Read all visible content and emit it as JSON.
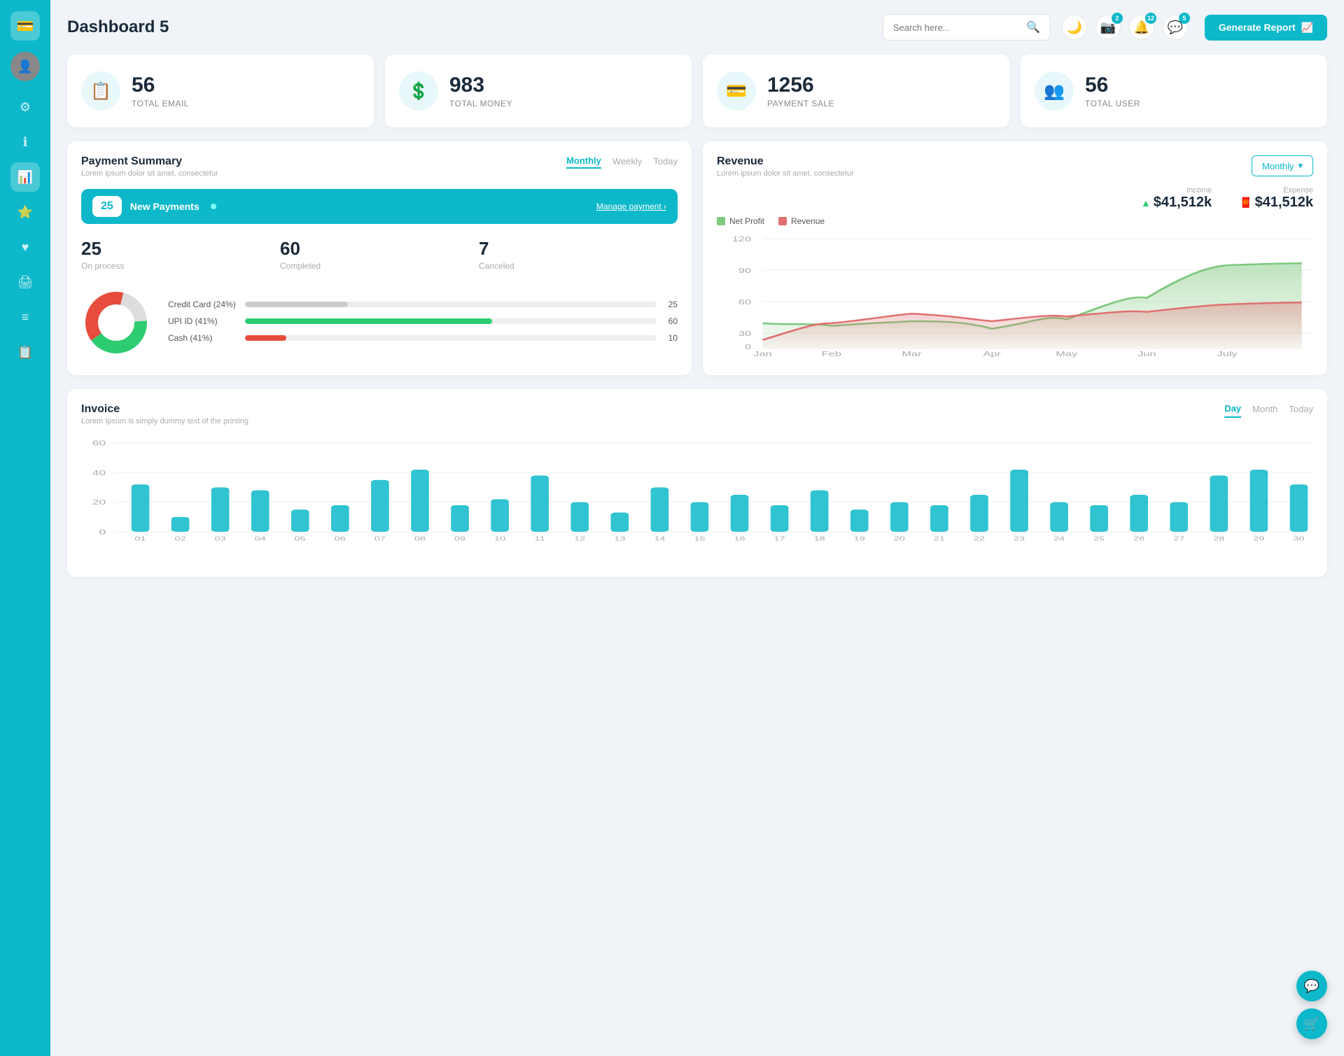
{
  "sidebar": {
    "logo_icon": "💳",
    "avatar_icon": "👤",
    "items": [
      {
        "icon": "⚙",
        "label": "settings",
        "active": false
      },
      {
        "icon": "ℹ",
        "label": "info",
        "active": false
      },
      {
        "icon": "📊",
        "label": "analytics",
        "active": true
      },
      {
        "icon": "⭐",
        "label": "favorites",
        "active": false
      },
      {
        "icon": "❤",
        "label": "likes",
        "active": false
      },
      {
        "icon": "🖨",
        "label": "print",
        "active": false
      },
      {
        "icon": "≡",
        "label": "menu",
        "active": false
      },
      {
        "icon": "📋",
        "label": "list",
        "active": false
      }
    ]
  },
  "header": {
    "title": "Dashboard 5",
    "search_placeholder": "Search here...",
    "badge_camera": "2",
    "badge_bell": "12",
    "badge_chat": "5",
    "generate_btn": "Generate Report"
  },
  "stats": [
    {
      "value": "56",
      "label": "TOTAL EMAIL",
      "icon": "📋"
    },
    {
      "value": "983",
      "label": "TOTAL MONEY",
      "icon": "$"
    },
    {
      "value": "1256",
      "label": "PAYMENT SALE",
      "icon": "💳"
    },
    {
      "value": "56",
      "label": "TOTAL USER",
      "icon": "👥"
    }
  ],
  "payment_summary": {
    "title": "Payment Summary",
    "subtitle": "Lorem ipsum dolor sit amet, consectetur",
    "tabs": [
      "Monthly",
      "Weekly",
      "Today"
    ],
    "active_tab": "Monthly",
    "new_payments_count": "25",
    "new_payments_label": "New Payments",
    "manage_payment": "Manage payment",
    "on_process": "25",
    "on_process_label": "On process",
    "completed": "60",
    "completed_label": "Completed",
    "canceled": "7",
    "canceled_label": "Canceled",
    "progress_bars": [
      {
        "label": "Credit Card (24%)",
        "value": 25,
        "color": "#cccccc",
        "count": "25"
      },
      {
        "label": "UPI ID (41%)",
        "value": 60,
        "color": "#2ecc71",
        "count": "60"
      },
      {
        "label": "Cash (41%)",
        "value": 10,
        "color": "#e74c3c",
        "count": "10"
      }
    ],
    "donut": {
      "segments": [
        {
          "color": "#dddddd",
          "pct": 24
        },
        {
          "color": "#2ecc71",
          "pct": 41
        },
        {
          "color": "#e74c3c",
          "pct": 35
        }
      ]
    }
  },
  "revenue": {
    "title": "Revenue",
    "subtitle": "Lorem ipsum dolor sit amet, consectetur",
    "monthly_btn": "Monthly",
    "income_label": "Income",
    "income_value": "$41,512k",
    "expense_label": "Expense",
    "expense_value": "$41,512k",
    "legend": [
      {
        "label": "Net Profit",
        "color": "#7ec87e"
      },
      {
        "label": "Revenue",
        "color": "#e07070"
      }
    ],
    "x_labels": [
      "Jan",
      "Feb",
      "Mar",
      "Apr",
      "May",
      "Jun",
      "July"
    ],
    "y_labels": [
      "0",
      "30",
      "60",
      "90",
      "120"
    ],
    "net_profit_data": [
      28,
      25,
      30,
      22,
      32,
      55,
      90,
      92
    ],
    "revenue_data": [
      10,
      28,
      38,
      30,
      35,
      40,
      48,
      50
    ]
  },
  "invoice": {
    "title": "Invoice",
    "subtitle": "Lorem Ipsum is simply dummy text of the printing",
    "tabs": [
      "Day",
      "Month",
      "Today"
    ],
    "active_tab": "Day",
    "y_labels": [
      "0",
      "20",
      "40",
      "60"
    ],
    "x_labels": [
      "01",
      "02",
      "03",
      "04",
      "05",
      "06",
      "07",
      "08",
      "09",
      "10",
      "11",
      "12",
      "13",
      "14",
      "15",
      "16",
      "17",
      "18",
      "19",
      "20",
      "21",
      "22",
      "23",
      "24",
      "25",
      "26",
      "27",
      "28",
      "29",
      "30"
    ],
    "bar_data": [
      32,
      10,
      30,
      28,
      15,
      18,
      35,
      42,
      18,
      22,
      38,
      20,
      13,
      30,
      20,
      25,
      18,
      28,
      15,
      20,
      18,
      25,
      42,
      20,
      18,
      25,
      20,
      38,
      42,
      32
    ]
  },
  "float_btns": [
    {
      "color": "#0cb8c9",
      "icon": "💬"
    },
    {
      "color": "#0cb8c9",
      "icon": "🛒"
    }
  ]
}
